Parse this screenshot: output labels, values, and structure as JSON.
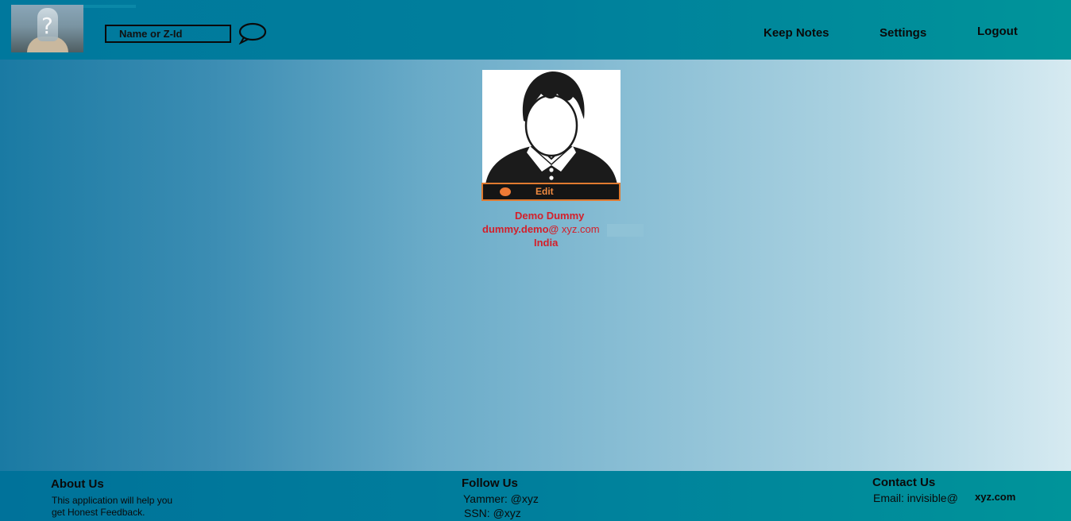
{
  "header": {
    "search": {
      "placeholder": "Name or Z-Id",
      "value": ""
    },
    "chat_icon": "speech-bubble",
    "nav": {
      "keep_notes": "Keep Notes",
      "settings": "Settings",
      "logout": "Logout"
    }
  },
  "profile": {
    "edit_label": "Edit",
    "name": "Demo Dummy",
    "email_user": "dummy.demo@",
    "email_domain": " xyz.com",
    "country": "India"
  },
  "footer": {
    "about": {
      "title": "About Us",
      "line1": "This application will help you",
      "line2": "get Honest Feedback."
    },
    "follow": {
      "title": "Follow Us",
      "yammer": "Yammer: @xyz",
      "ssn": "SSN: @xyz"
    },
    "contact": {
      "title": "Contact Us",
      "email_prefix": "Email: invisible@",
      "email_domain": "xyz.com"
    }
  },
  "colors": {
    "header": "#007f9c",
    "footer": "#007f9c",
    "profile_text": "#d41f2a",
    "edit_accent": "#e07a30"
  }
}
